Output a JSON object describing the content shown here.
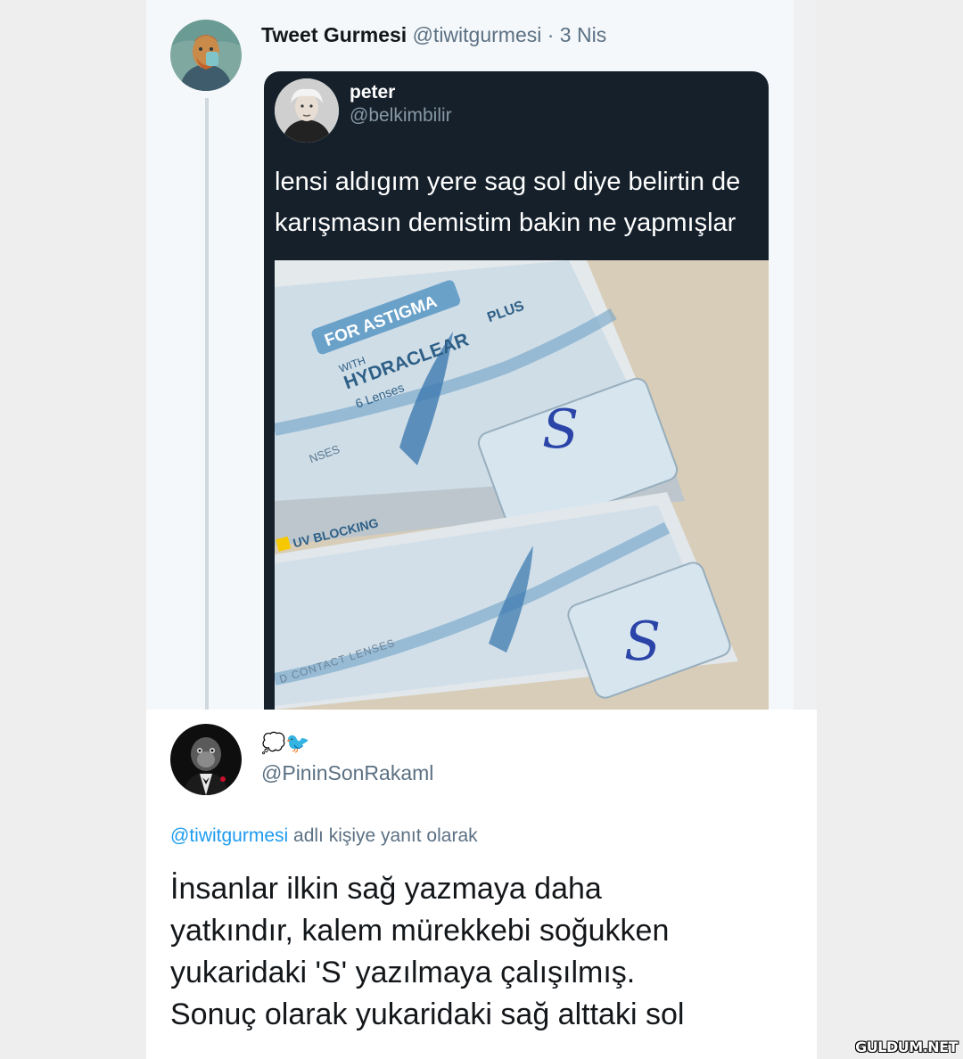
{
  "tweet": {
    "author_name": "Tweet Gurmesi",
    "author_handle": "@tiwitgurmesi",
    "separator": "·",
    "date": "3 Nis"
  },
  "embedded_tweet": {
    "author_name": "peter",
    "author_handle": "@belkimbilir",
    "text_line1": "lensi aldıgım yere sag sol diye belirtin de",
    "text_line2": "karışmasın demistim bakin ne yapmışlar",
    "photo": {
      "box_label_top": "FOR ASTIGMA",
      "box_label_with": "WITH",
      "box_label_brand": "HYDRACLEAR",
      "box_label_plus": "PLUS",
      "box_label_count": "6 Lenses",
      "box_label_side": "NSES",
      "box_label_uv": "UV BLOCKING",
      "box_label_lenses": "D CONTACT LENSES",
      "handwritten_1": "S",
      "handwritten_2": "S"
    }
  },
  "reply": {
    "author_name_emoji": "💭🐦",
    "author_handle": "@PininSonRakaml",
    "reply_to_handle": "@tiwitgurmesi",
    "reply_to_suffix": " adlı kişiye yanıt olarak",
    "text_line1": "İnsanlar ilkin sağ yazmaya daha",
    "text_line2": "yatkındır, kalem mürekkebi soğukken",
    "text_line3": "yukaridaki 'S' yazılmaya çalışılmış.",
    "text_line4": "Sonuç olarak yukaridaki sağ alttaki sol"
  },
  "watermark": "GULDUM.NET",
  "colors": {
    "link": "#1d9bf0",
    "embed_bg": "#15202b",
    "thread_line": "#cfd9de"
  }
}
